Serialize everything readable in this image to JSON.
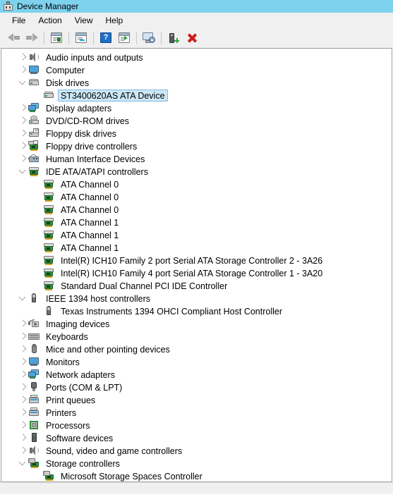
{
  "window": {
    "title": "Device Manager",
    "icon": "device-manager-icon"
  },
  "menubar": {
    "items": [
      {
        "label": "File"
      },
      {
        "label": "Action"
      },
      {
        "label": "View"
      },
      {
        "label": "Help"
      }
    ]
  },
  "toolbar": {
    "buttons": [
      {
        "name": "back-button",
        "icon": "back-arrow-icon",
        "enabled": false
      },
      {
        "name": "forward-button",
        "icon": "forward-arrow-icon",
        "enabled": false
      },
      {
        "name": "properties-button",
        "icon": "properties-icon"
      },
      {
        "name": "update-driver-button",
        "icon": "update-driver-icon"
      },
      {
        "name": "help-button",
        "icon": "help-icon"
      },
      {
        "name": "show-hidden-devices-button",
        "icon": "list-view-icon"
      },
      {
        "name": "scan-for-hardware-changes-button",
        "icon": "scan-monitor-icon"
      },
      {
        "name": "add-legacy-hardware-button",
        "icon": "add-device-icon"
      },
      {
        "name": "uninstall-device-button",
        "icon": "red-x-icon"
      }
    ]
  },
  "tree": {
    "nodes": [
      {
        "label": "Audio inputs and outputs",
        "indent": 0,
        "expander": "collapsed",
        "icon": "speaker-icon",
        "icon_class": "ic-speaker",
        "selected": false
      },
      {
        "label": "Computer",
        "indent": 0,
        "expander": "collapsed",
        "icon": "computer-monitor-icon",
        "icon_class": "ic-monitor",
        "selected": false
      },
      {
        "label": "Disk drives",
        "indent": 0,
        "expander": "expanded",
        "icon": "disk-drive-icon",
        "icon_class": "ic-disk",
        "selected": false
      },
      {
        "label": "ST3400620AS ATA Device",
        "indent": 1,
        "expander": "none",
        "icon": "disk-drive-icon",
        "icon_class": "ic-disk",
        "selected": true
      },
      {
        "label": "Display adapters",
        "indent": 0,
        "expander": "collapsed",
        "icon": "display-adapter-icon",
        "icon_class": "ic-netadapt",
        "selected": false
      },
      {
        "label": "DVD/CD-ROM drives",
        "indent": 0,
        "expander": "collapsed",
        "icon": "cd-rom-icon",
        "icon_class": "ic-cd",
        "selected": false
      },
      {
        "label": "Floppy disk drives",
        "indent": 0,
        "expander": "collapsed",
        "icon": "floppy-disk-icon",
        "icon_class": "ic-floppy",
        "selected": false
      },
      {
        "label": "Floppy drive controllers",
        "indent": 0,
        "expander": "collapsed",
        "icon": "floppy-controller-icon",
        "icon_class": "ic-card ic-fdc",
        "selected": false
      },
      {
        "label": "Human Interface Devices",
        "indent": 0,
        "expander": "collapsed",
        "icon": "hid-icon",
        "icon_class": "ic-hid",
        "selected": false
      },
      {
        "label": "IDE ATA/ATAPI controllers",
        "indent": 0,
        "expander": "expanded",
        "icon": "ide-controller-icon",
        "icon_class": "ic-card",
        "selected": false
      },
      {
        "label": "ATA Channel 0",
        "indent": 1,
        "expander": "none",
        "icon": "ide-controller-icon",
        "icon_class": "ic-card",
        "selected": false
      },
      {
        "label": "ATA Channel 0",
        "indent": 1,
        "expander": "none",
        "icon": "ide-controller-icon",
        "icon_class": "ic-card",
        "selected": false
      },
      {
        "label": "ATA Channel 0",
        "indent": 1,
        "expander": "none",
        "icon": "ide-controller-icon",
        "icon_class": "ic-card",
        "selected": false
      },
      {
        "label": "ATA Channel 1",
        "indent": 1,
        "expander": "none",
        "icon": "ide-controller-icon",
        "icon_class": "ic-card",
        "selected": false
      },
      {
        "label": "ATA Channel 1",
        "indent": 1,
        "expander": "none",
        "icon": "ide-controller-icon",
        "icon_class": "ic-card",
        "selected": false
      },
      {
        "label": "ATA Channel 1",
        "indent": 1,
        "expander": "none",
        "icon": "ide-controller-icon",
        "icon_class": "ic-card",
        "selected": false
      },
      {
        "label": "Intel(R) ICH10 Family 2 port Serial ATA Storage Controller 2 - 3A26",
        "indent": 1,
        "expander": "none",
        "icon": "ide-controller-icon",
        "icon_class": "ic-card",
        "selected": false
      },
      {
        "label": "Intel(R) ICH10 Family 4 port Serial ATA Storage Controller 1 - 3A20",
        "indent": 1,
        "expander": "none",
        "icon": "ide-controller-icon",
        "icon_class": "ic-card",
        "selected": false
      },
      {
        "label": "Standard Dual Channel PCI IDE Controller",
        "indent": 1,
        "expander": "none",
        "icon": "ide-controller-icon",
        "icon_class": "ic-card",
        "selected": false
      },
      {
        "label": "IEEE 1394 host controllers",
        "indent": 0,
        "expander": "expanded",
        "icon": "ieee1394-icon",
        "icon_class": "ic-1394",
        "selected": false
      },
      {
        "label": "Texas Instruments 1394 OHCI Compliant Host Controller",
        "indent": 1,
        "expander": "none",
        "icon": "ieee1394-icon",
        "icon_class": "ic-1394",
        "selected": false
      },
      {
        "label": "Imaging devices",
        "indent": 0,
        "expander": "collapsed",
        "icon": "camera-icon",
        "icon_class": "ic-camera",
        "selected": false
      },
      {
        "label": "Keyboards",
        "indent": 0,
        "expander": "collapsed",
        "icon": "keyboard-icon",
        "icon_class": "ic-keyboard",
        "selected": false
      },
      {
        "label": "Mice and other pointing devices",
        "indent": 0,
        "expander": "collapsed",
        "icon": "mouse-icon",
        "icon_class": "ic-mouse",
        "selected": false
      },
      {
        "label": "Monitors",
        "indent": 0,
        "expander": "collapsed",
        "icon": "monitor-icon",
        "icon_class": "ic-monitor",
        "selected": false
      },
      {
        "label": "Network adapters",
        "indent": 0,
        "expander": "collapsed",
        "icon": "network-adapter-icon",
        "icon_class": "ic-netadapt",
        "selected": false
      },
      {
        "label": "Ports (COM & LPT)",
        "indent": 0,
        "expander": "collapsed",
        "icon": "port-icon",
        "icon_class": "ic-port",
        "selected": false
      },
      {
        "label": "Print queues",
        "indent": 0,
        "expander": "collapsed",
        "icon": "printer-icon",
        "icon_class": "ic-printer",
        "selected": false
      },
      {
        "label": "Printers",
        "indent": 0,
        "expander": "collapsed",
        "icon": "printer-icon",
        "icon_class": "ic-printer",
        "selected": false
      },
      {
        "label": "Processors",
        "indent": 0,
        "expander": "collapsed",
        "icon": "processor-icon",
        "icon_class": "ic-cpu",
        "selected": false
      },
      {
        "label": "Software devices",
        "indent": 0,
        "expander": "collapsed",
        "icon": "software-device-icon",
        "icon_class": "ic-software",
        "selected": false
      },
      {
        "label": "Sound, video and game controllers",
        "indent": 0,
        "expander": "collapsed",
        "icon": "speaker-icon",
        "icon_class": "ic-speaker",
        "selected": false
      },
      {
        "label": "Storage controllers",
        "indent": 0,
        "expander": "expanded",
        "icon": "storage-controller-icon",
        "icon_class": "ic-storage",
        "selected": false
      },
      {
        "label": "Microsoft Storage Spaces Controller",
        "indent": 1,
        "expander": "none",
        "icon": "storage-controller-icon",
        "icon_class": "ic-storage",
        "selected": false
      }
    ]
  },
  "statusbar": {
    "text": ""
  },
  "colors": {
    "titlebar": "#7ed2ee",
    "chrome": "#f0f0f0",
    "selection_fill": "#cce8f7",
    "selection_border": "#7fb8de",
    "accent_green": "#2f8f3c",
    "accent_red": "#d01c1c"
  }
}
